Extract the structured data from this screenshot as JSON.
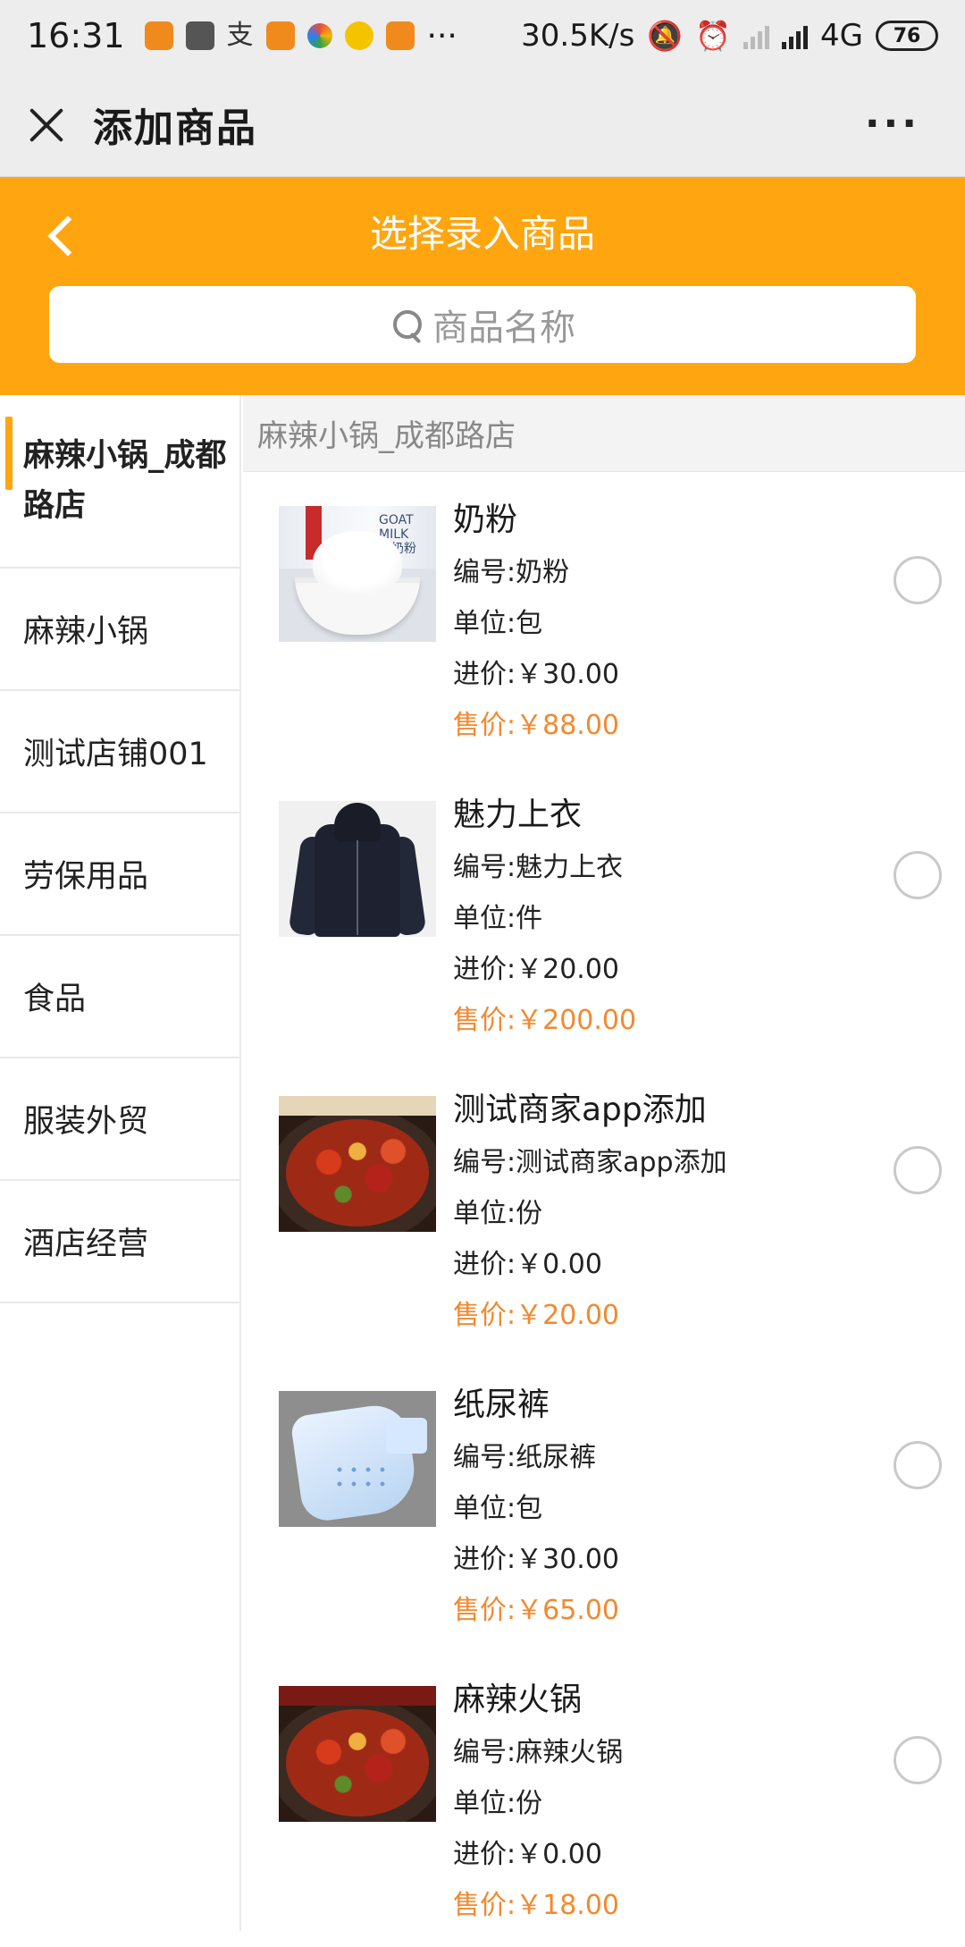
{
  "status_bar": {
    "time": "16:31",
    "dots": "···",
    "speed": "30.5K/s",
    "network": "4G",
    "battery": "76"
  },
  "titlebar": {
    "title": "添加商品",
    "more": "···"
  },
  "header": {
    "title": "选择录入商品",
    "search_placeholder": "商品名称"
  },
  "sidebar": {
    "items": [
      {
        "label": "麻辣小锅_成都路店",
        "active": true
      },
      {
        "label": "麻辣小锅",
        "active": false
      },
      {
        "label": "测试店铺001",
        "active": false
      },
      {
        "label": "劳保用品",
        "active": false
      },
      {
        "label": "食品",
        "active": false
      },
      {
        "label": "服装外贸",
        "active": false
      },
      {
        "label": "酒店经营",
        "active": false
      }
    ]
  },
  "shop_title": "麻辣小锅_成都路店",
  "products": [
    {
      "name": "奶粉",
      "code": "编号:奶粉",
      "unit": "单位:包",
      "cost": "进价:￥30.00",
      "price": "售价:￥88.00",
      "thumb": "milk-powder-image"
    },
    {
      "name": "魅力上衣",
      "code": "编号:魅力上衣",
      "unit": "单位:件",
      "cost": "进价:￥20.00",
      "price": "售价:￥200.00",
      "thumb": "jacket-image"
    },
    {
      "name": "测试商家app添加",
      "code": "编号:测试商家app添加",
      "unit": "单位:份",
      "cost": "进价:￥0.00",
      "price": "售价:￥20.00",
      "thumb": "hotpot-image"
    },
    {
      "name": "纸尿裤",
      "code": "编号:纸尿裤",
      "unit": "单位:包",
      "cost": "进价:￥30.00",
      "price": "售价:￥65.00",
      "thumb": "diaper-image"
    },
    {
      "name": "麻辣火锅",
      "code": "编号:麻辣火锅",
      "unit": "单位:份",
      "cost": "进价:￥0.00",
      "price": "售价:￥18.00",
      "thumb": "hotpot-image"
    }
  ],
  "colors": {
    "accent": "#ffa50f",
    "price": "#f2892f"
  }
}
